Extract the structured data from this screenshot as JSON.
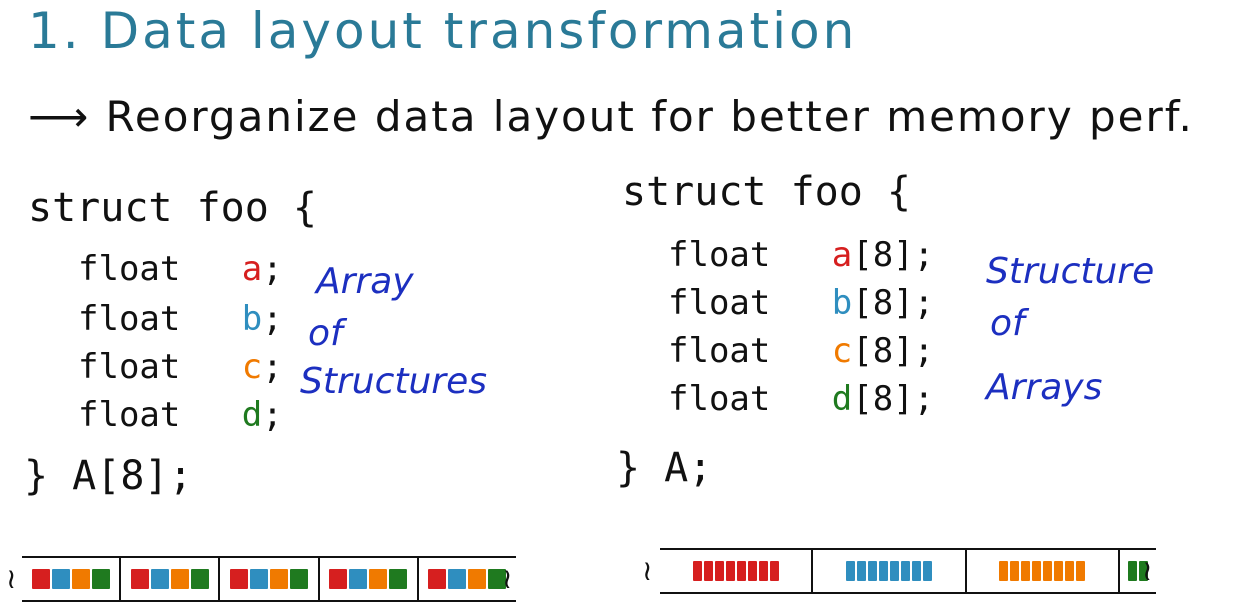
{
  "title": "1. Data layout transformation",
  "subtitle": "⟶ Reorganize data layout for better memory perf.",
  "colors": {
    "a": "#d61f1f",
    "b": "#2f8ebf",
    "c": "#f07a00",
    "d": "#1f7a1f",
    "note": "#1c2fc0",
    "title": "#2a7a97"
  },
  "aos": {
    "struct_open": "struct foo {",
    "fields": [
      {
        "type": "float",
        "name": "a",
        "suffix": ";"
      },
      {
        "type": "float",
        "name": "b",
        "suffix": ";"
      },
      {
        "type": "float",
        "name": "c",
        "suffix": ";"
      },
      {
        "type": "float",
        "name": "d",
        "suffix": ";"
      }
    ],
    "struct_close": "} A[8];",
    "note_line1": "Array",
    "note_line2": "of",
    "note_line3": "Structures",
    "memory_group_count": 5
  },
  "soa": {
    "struct_open": "struct foo {",
    "fields": [
      {
        "type": "float",
        "name": "a",
        "suffix": "[8];"
      },
      {
        "type": "float",
        "name": "b",
        "suffix": "[8];"
      },
      {
        "type": "float",
        "name": "c",
        "suffix": "[8];"
      },
      {
        "type": "float",
        "name": "d",
        "suffix": "[8];"
      }
    ],
    "struct_close": "} A;",
    "note_line1": "Structure",
    "note_line2": "of",
    "note_line3": "Arrays",
    "memory_groups": [
      "a",
      "b",
      "c",
      "d"
    ],
    "memory_elements_per_group": 8
  }
}
